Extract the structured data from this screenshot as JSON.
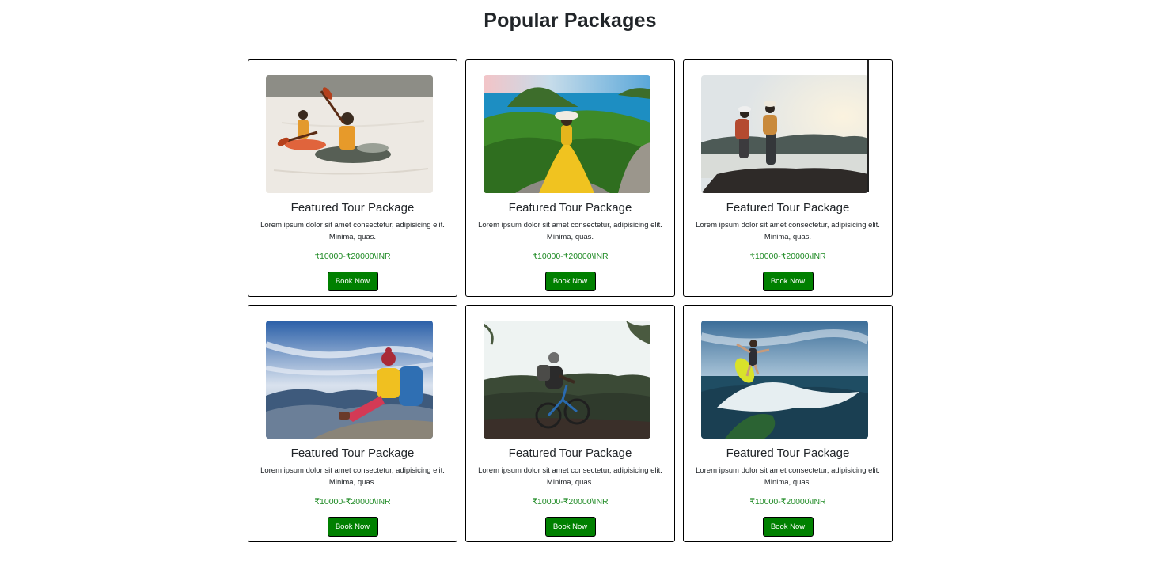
{
  "page": {
    "title": "Popular Packages"
  },
  "packages": [
    {
      "image": "kayaking-photo",
      "title": "Featured Tour Package",
      "description": "Lorem ipsum dolor sit amet consectetur, adipisicing elit. Minima, quas.",
      "price": "₹10000-₹20000\\INR",
      "button_label": "Book Now"
    },
    {
      "image": "island-view-photo",
      "title": "Featured Tour Package",
      "description": "Lorem ipsum dolor sit amet consectetur, adipisicing elit. Minima, quas.",
      "price": "₹10000-₹20000\\INR",
      "button_label": "Book Now"
    },
    {
      "image": "hikers-lake-photo",
      "title": "Featured Tour Package",
      "description": "Lorem ipsum dolor sit amet consectetur, adipisicing elit. Minima, quas.",
      "price": "₹10000-₹20000\\INR",
      "button_label": "Book Now"
    },
    {
      "image": "mountain-hiker-photo",
      "title": "Featured Tour Package",
      "description": "Lorem ipsum dolor sit amet consectetur, adipisicing elit. Minima, quas.",
      "price": "₹10000-₹20000\\INR",
      "button_label": "Book Now"
    },
    {
      "image": "mountain-biker-photo",
      "title": "Featured Tour Package",
      "description": "Lorem ipsum dolor sit amet consectetur, adipisicing elit. Minima, quas.",
      "price": "₹10000-₹20000\\INR",
      "button_label": "Book Now"
    },
    {
      "image": "wakesurfer-photo",
      "title": "Featured Tour Package",
      "description": "Lorem ipsum dolor sit amet consectetur, adipisicing elit. Minima, quas.",
      "price": "₹10000-₹20000\\INR",
      "button_label": "Book Now"
    }
  ],
  "colors": {
    "button_bg": "#008000",
    "price_text": "#1e8a24",
    "card_border": "#000000"
  }
}
